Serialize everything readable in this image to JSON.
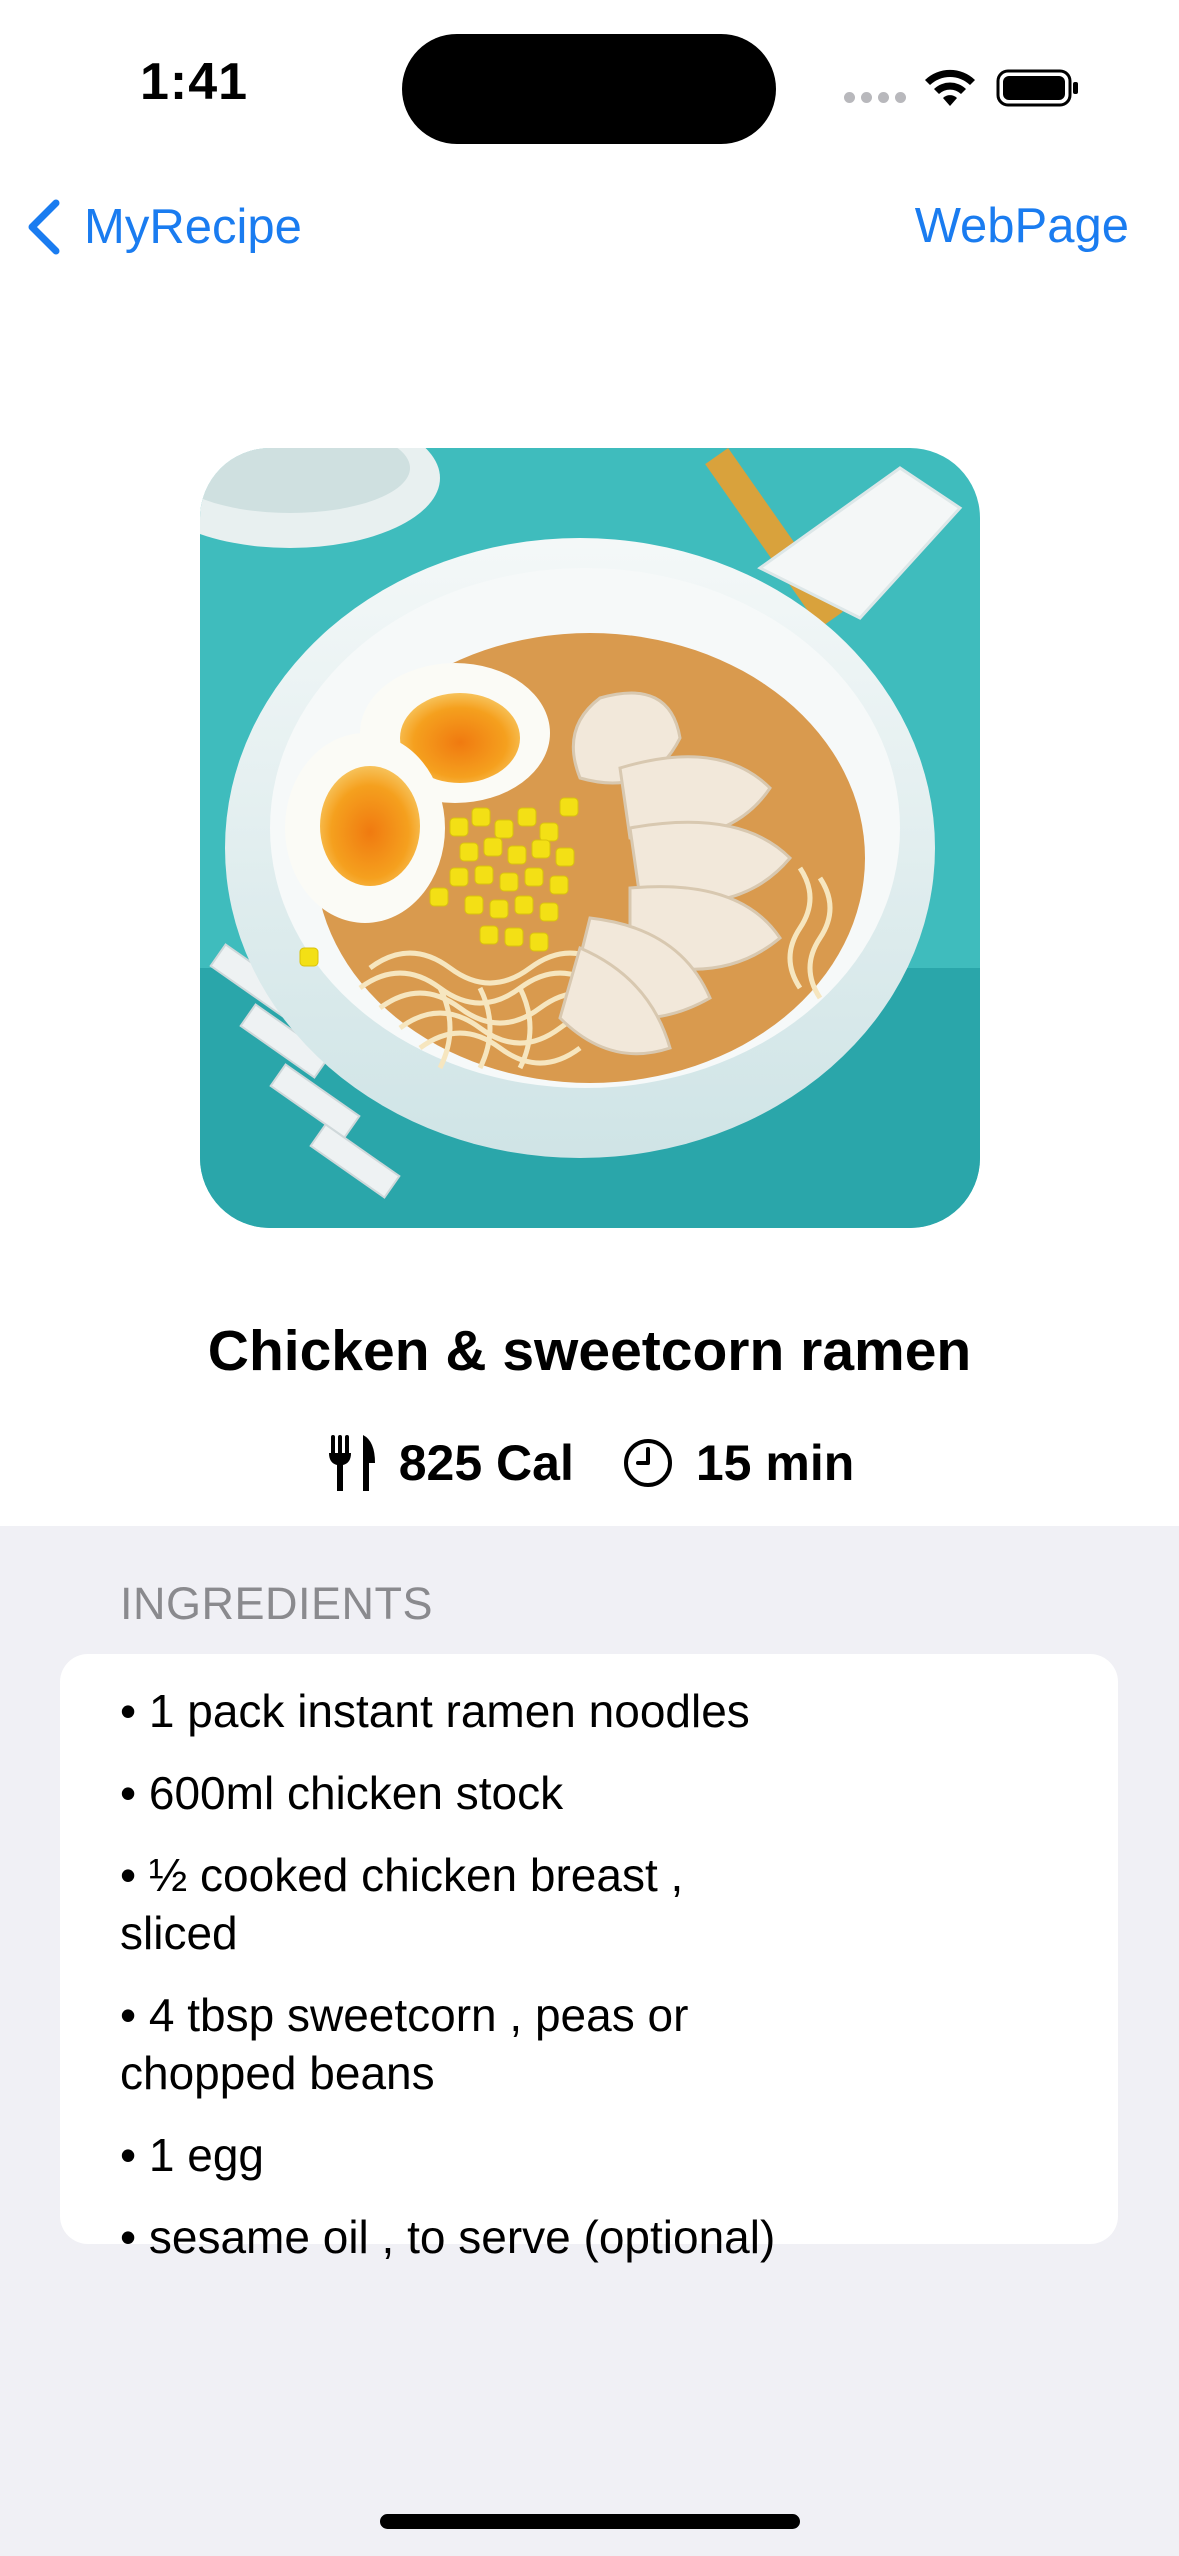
{
  "status_bar": {
    "time": "1:41"
  },
  "nav": {
    "back_label": "MyRecipe",
    "right_button_label": "WebPage",
    "accent_color": "#1a7cf0"
  },
  "recipe": {
    "title": "Chicken & sweetcorn ramen",
    "image_icon": "ramen-photo",
    "calories": "825 Cal",
    "time": "15 min",
    "calories_icon": "fork-knife-icon",
    "time_icon": "clock-icon"
  },
  "ingredients": {
    "header": "INGREDIENTS",
    "items": [
      "• 1 pack instant ramen noodles",
      "• 600ml chicken stock",
      "• ½ cooked chicken breast , sliced",
      "• 4 tbsp sweetcorn , peas or chopped beans",
      "• 1 egg",
      "• sesame oil , to serve (optional)"
    ]
  },
  "colors": {
    "grouped_background": "#f0f0f5",
    "secondary_text": "#8a8a8e"
  }
}
